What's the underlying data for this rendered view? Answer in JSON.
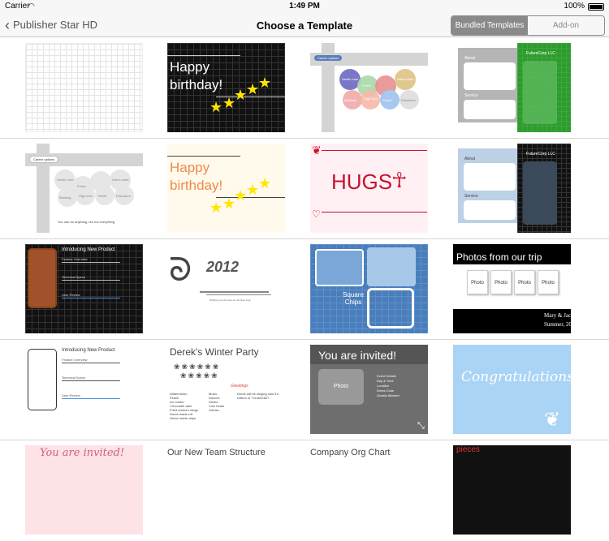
{
  "status": {
    "carrier": "Carrier",
    "time": "1:49 PM",
    "battery": "100%"
  },
  "nav": {
    "back_label": "Publisher Star HD",
    "title": "Choose a Template"
  },
  "segment": {
    "bundled": "Bundled Templates",
    "addon": "Add-on"
  },
  "tiles": {
    "r1c2": {
      "line1": "Happy",
      "line2": "birthday!"
    },
    "r1c3": {
      "pill": "Career options",
      "c1": "Health care",
      "c2": "Police",
      "c3": "Hand crafts",
      "c4": "Banking",
      "c5": "High tech",
      "c6": "Retail",
      "c7": "Education"
    },
    "r1c4": {
      "company": "FutureCorp LLC",
      "about": "About",
      "service": "Service"
    },
    "r2c1": {
      "pill": "Career options",
      "c1": "Health care",
      "c2": "Police",
      "c3": "Hand crafts",
      "c4": "Banking",
      "c5": "High tech",
      "c6": "Retail",
      "c7": "Education",
      "footer": "You can do anything, but not everything"
    },
    "r2c2": {
      "line1": "Happy",
      "line2": "birthday!"
    },
    "r2c3": {
      "word": "HUGS"
    },
    "r2c4": {
      "company": "FutureCorp LLC",
      "about": "About",
      "service": "Service"
    },
    "r3c1": {
      "title": "Introducing New Product",
      "i1": "Feature Overview",
      "i2": "Technical Specs",
      "i3": "User Review"
    },
    "r3c2": {
      "year": "2012",
      "caption": "Wishing you the best for the New Year"
    },
    "r3c3": {
      "title": "Square Chips"
    },
    "r3c4": {
      "title": "Photos from our trip",
      "photo": "Photo",
      "names": "Mary & Jac",
      "season": "Summer, 20"
    },
    "r4c1": {
      "title": "Introducing New Product",
      "i1": "Feature Overview",
      "i2": "Technical Specs",
      "i3": "User Review"
    },
    "r4c2": {
      "title": "Derek's Winter Party",
      "menu": [
        "Watermelon",
        "Peach",
        "Ice cream",
        "Chocolate cake",
        "Fried chicken wings",
        "Home made roll",
        "Home made chips"
      ],
      "menu2": [
        "Music",
        "Dances",
        "Drinks",
        "Cool beats",
        "Games"
      ],
      "note_head": "Greetings",
      "note": "Derek will be singing solo it's edition of \"Cinderella\"!"
    },
    "r4c3": {
      "title": "You are invited!",
      "photo": "Photo",
      "d1": "Event Details",
      "d2": "Day & Time",
      "d3": "Location",
      "d4": "Dress Code",
      "d5": "Guests Allowed"
    },
    "r4c4": {
      "title": "Congratulations!"
    },
    "r5c1": {
      "title": "You are invited!"
    },
    "r5c2": {
      "title": "Our New Team Structure"
    },
    "r5c3": {
      "title": "Company Org Chart"
    },
    "r5c4": {
      "title": "pieces"
    }
  }
}
